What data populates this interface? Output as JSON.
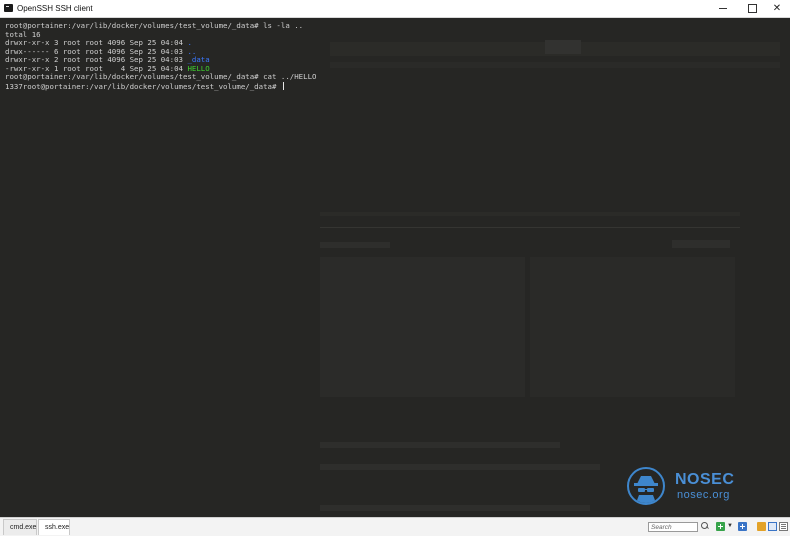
{
  "window": {
    "title": "OpenSSH SSH client",
    "minimize_label": "",
    "maximize_label": "",
    "close_label": "✕"
  },
  "terminal": {
    "lines": [
      {
        "segments": [
          {
            "text": "root@portainer:/var/lib/docker/volumes/test_volume/_data# ls -la ..",
            "color": "default"
          }
        ]
      },
      {
        "segments": [
          {
            "text": "total 16",
            "color": "default"
          }
        ]
      },
      {
        "segments": [
          {
            "text": "drwxr-xr-x 3 root root 4096 Sep 25 04:04 ",
            "color": "default"
          },
          {
            "text": ".",
            "color": "directory"
          }
        ]
      },
      {
        "segments": [
          {
            "text": "drwx------ 6 root root 4096 Sep 25 04:03 ",
            "color": "default"
          },
          {
            "text": "..",
            "color": "directory"
          }
        ]
      },
      {
        "segments": [
          {
            "text": "drwxr-xr-x 2 root root 4096 Sep 25 04:03 ",
            "color": "default"
          },
          {
            "text": "_data",
            "color": "directory"
          }
        ]
      },
      {
        "segments": [
          {
            "text": "-rwxr-xr-x 1 root root    4 Sep 25 04:04 ",
            "color": "default"
          },
          {
            "text": "HELLO",
            "color": "executable"
          }
        ]
      },
      {
        "segments": [
          {
            "text": "root@portainer:/var/lib/docker/volumes/test_volume/_data# cat ../HELLO",
            "color": "default"
          }
        ]
      },
      {
        "segments": [
          {
            "text": "1337root@portainer:/var/lib/docker/volumes/test_volume/_data# ",
            "color": "default"
          }
        ],
        "cursor": true
      }
    ]
  },
  "watermark": {
    "brand": "NOSEC",
    "url": "nosec.org",
    "icon": "spy-icon"
  },
  "taskbar": {
    "tabs": [
      {
        "label": "cmd.exe",
        "active": false
      },
      {
        "label": "ssh.exe",
        "active": true
      }
    ],
    "search_placeholder": "Search",
    "icons": [
      "search-icon",
      "add-icon",
      "dropdown-icon",
      "plus-icon",
      "lock-icon",
      "layout-icon",
      "menu-icon"
    ]
  },
  "colors": {
    "background": "#262624",
    "text": "#cfcfcf",
    "directory": "#3b78ff",
    "executable": "#3fd12e",
    "accent": "#4a8fd6"
  }
}
